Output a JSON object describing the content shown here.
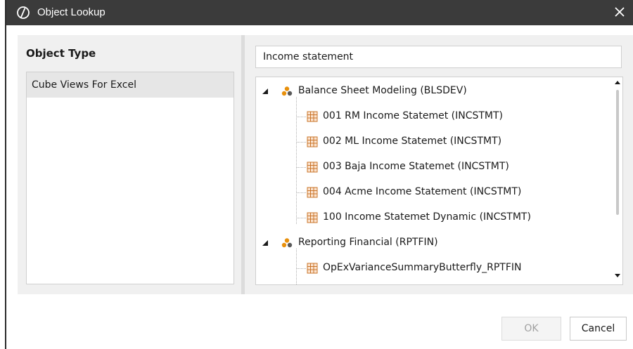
{
  "window": {
    "title": "Object Lookup"
  },
  "left_pane": {
    "heading": "Object Type",
    "items": [
      {
        "label": "Cube Views For Excel",
        "selected": true
      }
    ]
  },
  "search": {
    "value": "Income statement"
  },
  "tree": {
    "groups": [
      {
        "label": "Balance Sheet Modeling (BLSDEV)",
        "expanded": true,
        "children": [
          "001 RM Income Statemet (INCSTMT)",
          "002 ML Income Statemet (INCSTMT)",
          "003 Baja Income Statemet (INCSTMT)",
          "004 Acme Income Statement (INCSTMT)",
          "100 Income Statemet Dynamic (INCSTMT)"
        ]
      },
      {
        "label": "Reporting Financial (RPTFIN)",
        "expanded": true,
        "children": [
          "OpExVarianceSummaryButterfly_RPTFIN"
        ]
      }
    ]
  },
  "buttons": {
    "ok": "OK",
    "cancel": "Cancel",
    "ok_enabled": false
  },
  "colors": {
    "titlebar": "#3b3b3b",
    "pane": "#f0f0f0",
    "selected_item": "#e6e6e6",
    "group_icon": "#e8900c",
    "grid_icon": "#c9742a"
  }
}
